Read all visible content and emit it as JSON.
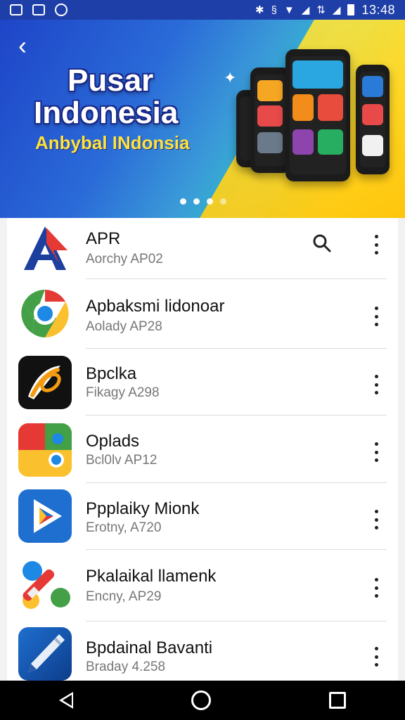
{
  "status_bar": {
    "time": "13:48",
    "icons": [
      "gallery-icon",
      "square-icon",
      "sync-icon",
      "bluetooth-icon",
      "vibrate-icon",
      "wifi-icon",
      "signal-icon",
      "data-icon",
      "signal-icon-2",
      "battery-icon"
    ]
  },
  "banner": {
    "title_line1": "Pusar",
    "title_line2": "Indonesia",
    "subtitle": "Anbybal INdonsia",
    "carousel_dots": 4,
    "active_dot": 0
  },
  "apps": [
    {
      "name": "APR",
      "subtitle": "Aorchy AP02",
      "icon": "apr-logo-icon",
      "has_search": true
    },
    {
      "name": "Apbaksmi lidonoar",
      "subtitle": "Aolady AP28",
      "icon": "chrome-icon"
    },
    {
      "name": "Bpclka",
      "subtitle": "Fikagy A298",
      "icon": "pen-swoosh-icon"
    },
    {
      "name": "Oplads",
      "subtitle": "Bcl0lv AP12",
      "icon": "maps-icon"
    },
    {
      "name": "Ppplaiky Mionk",
      "subtitle": "Erotny, A720",
      "icon": "play-icon"
    },
    {
      "name": "Pkalaikal llamenk",
      "subtitle": "Encny, AP29",
      "icon": "marker-icon"
    },
    {
      "name": "Bpdainal Bavanti",
      "subtitle": "Braday 4.258",
      "icon": "pen-nib-icon"
    }
  ],
  "colors": {
    "status_bar": "#1e3fa8",
    "banner_blue": "#1e45c8",
    "banner_yellow": "#ffd22a",
    "nav_bar": "#000000"
  }
}
